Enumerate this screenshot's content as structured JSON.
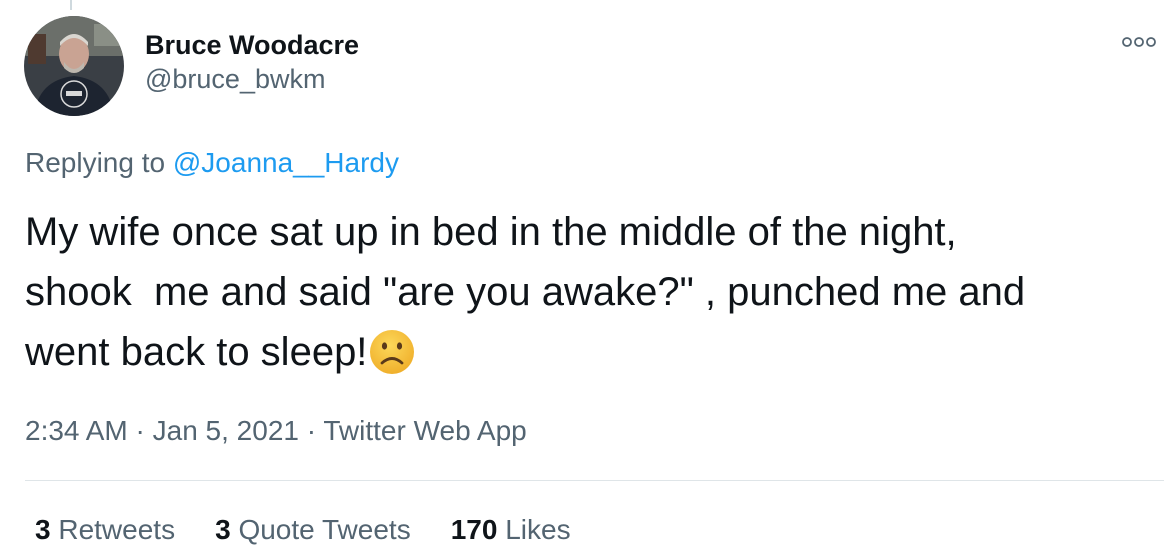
{
  "tweet": {
    "author": {
      "display_name": "Bruce Woodacre",
      "handle": "@bruce_bwkm"
    },
    "replying_prefix": "Replying to",
    "replying_to": "@Joanna__Hardy",
    "text": "My wife once sat up in bed in the middle of the night,\nshook  me and said \"are you awake?\" , punched me and\nwent back to sleep!",
    "emoji_icon": "frowning-face-icon",
    "time": "2:34 AM",
    "date": "Jan 5, 2021",
    "separator": "·",
    "source": "Twitter Web App",
    "stats": {
      "retweets_count": "3",
      "retweets_label": "Retweets",
      "quote_tweets_count": "3",
      "quote_tweets_label": "Quote Tweets",
      "likes_count": "170",
      "likes_label": "Likes"
    }
  },
  "colors": {
    "primary_text": "#0f1419",
    "secondary_text": "#536471",
    "link": "#1d9bf0",
    "emoji_fill": "#f7c23d"
  }
}
